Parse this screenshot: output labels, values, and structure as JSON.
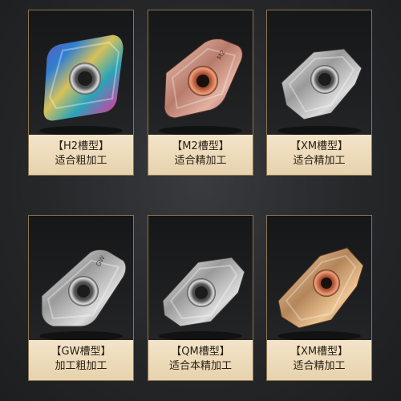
{
  "cards": [
    {
      "title": "【H2槽型】",
      "subtitle": "适合粗加工",
      "finish": "rainbow"
    },
    {
      "title": "【M2槽型】",
      "subtitle": "适合精加工",
      "finish": "rose-gold"
    },
    {
      "title": "【XM槽型】",
      "subtitle": "适合精加工",
      "finish": "silver"
    },
    {
      "title": "【GW槽型】",
      "subtitle": "加工粗加工",
      "finish": "silver"
    },
    {
      "title": "【QM槽型】",
      "subtitle": "适合本精加工",
      "finish": "silver"
    },
    {
      "title": "【XM槽型】",
      "subtitle": "适合精加工",
      "finish": "gold"
    }
  ]
}
